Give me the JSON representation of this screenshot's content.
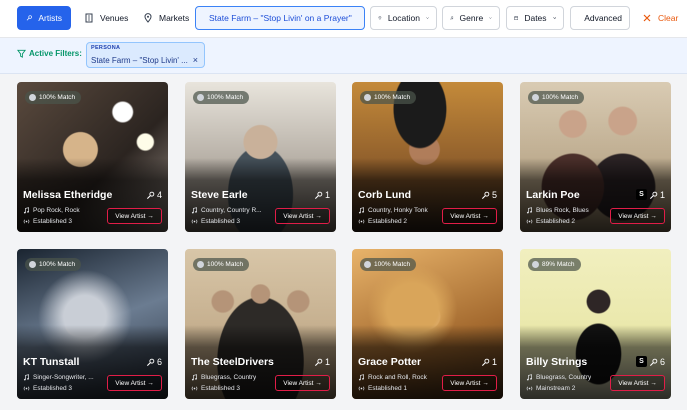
{
  "toolbar": {
    "artists_label": "Artists",
    "venues_label": "Venues",
    "markets_label": "Markets",
    "persona_label": "State Farm – \"Stop Livin' on a Prayer\"",
    "location_label": "Location",
    "genre_label": "Genre",
    "dates_label": "Dates",
    "advanced_label": "Advanced",
    "clear_label": "Clear"
  },
  "filters": {
    "label": "Active Filters:",
    "chip": {
      "title": "PERSONA",
      "value": "State Farm – \"Stop Livin' ...",
      "remove": "×"
    }
  },
  "colors": {
    "accent": "#2563eb",
    "clear": "#ea580c",
    "view_border": "#e11d48",
    "filters_bg": "#eef4ff"
  },
  "view_label": "View Artist →",
  "artists": [
    {
      "name": "Melissa Etheridge",
      "match": "100% Match",
      "count": "4",
      "genres": "Pop Rock, Rock",
      "established": "Established 3",
      "spotify": false
    },
    {
      "name": "Steve Earle",
      "match": "100% Match",
      "count": "1",
      "genres": "Country, Country R...",
      "established": "Established 3",
      "spotify": false
    },
    {
      "name": "Corb Lund",
      "match": "100% Match",
      "count": "5",
      "genres": "Country, Honky Tonk",
      "established": "Established 2",
      "spotify": false
    },
    {
      "name": "Larkin Poe",
      "match": "100% Match",
      "count": "1",
      "genres": "Blues Rock, Blues",
      "established": "Established 2",
      "spotify": true
    },
    {
      "name": "KT Tunstall",
      "match": "100% Match",
      "count": "6",
      "genres": "Singer-Songwriter, ...",
      "established": "Established 3",
      "spotify": false
    },
    {
      "name": "The SteelDrivers",
      "match": "100% Match",
      "count": "1",
      "genres": "Bluegrass, Country",
      "established": "Established 3",
      "spotify": false
    },
    {
      "name": "Grace Potter",
      "match": "100% Match",
      "count": "1",
      "genres": "Rock and Roll, Rock",
      "established": "Established 1",
      "spotify": false
    },
    {
      "name": "Billy Strings",
      "match": "89% Match",
      "count": "6",
      "genres": "Bluegrass, Country",
      "established": "Mainstream 2",
      "spotify": true
    }
  ],
  "spotify_glyph": "S"
}
